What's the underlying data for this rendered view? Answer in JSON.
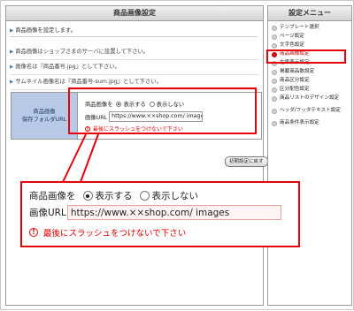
{
  "main": {
    "title": "商品画像設定",
    "intro": "商品画像を設定します。",
    "notes": [
      "商品画像はショップさまのサーバに設置して下さい。",
      "画像名は『商品番号.jpg』として下さい。",
      "サムネイル画像名は『商品番号-sum.jpg』として下さい。"
    ],
    "setting": {
      "label_line1": "商品画像",
      "label_line2": "保存フォルダURL",
      "image_label": "商品画像を",
      "option_show": "表示する",
      "option_hide": "表示しない",
      "url_label": "画像URL",
      "url_value": "https://www.××shop.com/ images",
      "warning": "最後にスラッシュをつけないで下さい"
    },
    "reset_button": "初期設定に戻す"
  },
  "menu": {
    "title": "設定メニュー",
    "items": [
      "テンプレート選択",
      "ページ設定",
      "文字色設定",
      "商品画像設定",
      "在庫表示設定",
      "掲載商品数設定",
      "商品区分設定",
      "区分配色設定",
      "商品リストのデザイン設定",
      "ヘッダ/フッタテキスト設定",
      "商品条件表示設定"
    ],
    "active_item": "商品画像設定"
  },
  "callout": {
    "image_label": "商品画像を",
    "option_show": "表示する",
    "option_hide": "表示しない",
    "url_label": "画像URL",
    "url_value": "https://www.××shop.com/ images",
    "warning": "最後にスラッシュをつけないで下さい"
  },
  "colors": {
    "highlight": "#e8000b",
    "label_bg": "#b7c9e6",
    "warning": "#e00000"
  }
}
